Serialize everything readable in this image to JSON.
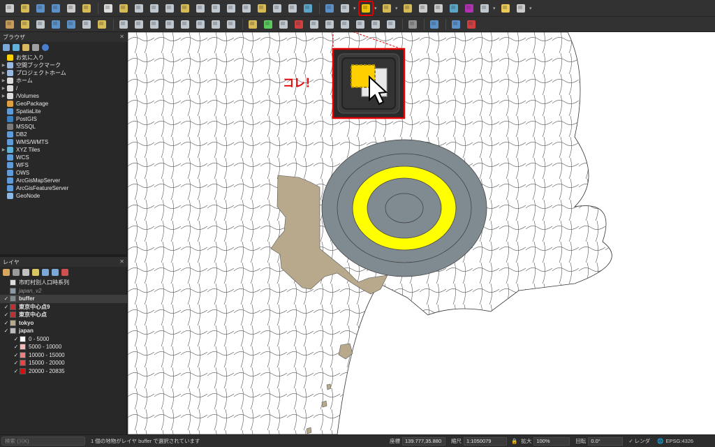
{
  "panels": {
    "browser": {
      "title": "ブラウザ",
      "items": [
        {
          "label": "お気に入り",
          "icon": "star-icon",
          "expand": false
        },
        {
          "label": "空間ブックマーク",
          "icon": "bookmark-icon",
          "expand": true
        },
        {
          "label": "プロジェクトホーム",
          "icon": "project-home-icon",
          "expand": true
        },
        {
          "label": "ホーム",
          "icon": "home-folder-icon",
          "expand": true
        },
        {
          "label": "/",
          "icon": "root-folder-icon",
          "expand": true
        },
        {
          "label": "/Volumes",
          "icon": "folder-icon",
          "expand": true
        },
        {
          "label": "GeoPackage",
          "icon": "geopackage-icon",
          "expand": false
        },
        {
          "label": "SpatiaLite",
          "icon": "spatialite-icon",
          "expand": false
        },
        {
          "label": "PostGIS",
          "icon": "postgis-icon",
          "expand": false
        },
        {
          "label": "MSSQL",
          "icon": "mssql-icon",
          "expand": false
        },
        {
          "label": "DB2",
          "icon": "db2-icon",
          "expand": false
        },
        {
          "label": "WMS/WMTS",
          "icon": "wms-icon",
          "expand": false
        },
        {
          "label": "XYZ Tiles",
          "icon": "xyz-tiles-icon",
          "expand": true
        },
        {
          "label": "WCS",
          "icon": "wcs-icon",
          "expand": false
        },
        {
          "label": "WFS",
          "icon": "wfs-icon",
          "expand": false
        },
        {
          "label": "OWS",
          "icon": "ows-icon",
          "expand": false
        },
        {
          "label": "ArcGisMapServer",
          "icon": "arcgis-map-icon",
          "expand": false
        },
        {
          "label": "ArcGisFeatureServer",
          "icon": "arcgis-feature-icon",
          "expand": false
        },
        {
          "label": "GeoNode",
          "icon": "geonode-icon",
          "expand": false
        }
      ]
    },
    "layers": {
      "title": "レイヤ",
      "items": [
        {
          "label": "市町村別人口時系列",
          "checked": false,
          "swatch": "#dddddd",
          "style": "normal",
          "indent": 0
        },
        {
          "label": "japan_v2",
          "checked": false,
          "swatch": "#8a9aa8",
          "style": "italic",
          "indent": 0
        },
        {
          "label": "buffer",
          "checked": true,
          "swatch": "#7f8a91",
          "style": "bold",
          "indent": 0
        },
        {
          "label": "東京中心点9",
          "checked": true,
          "swatch": "#c03030",
          "style": "bold",
          "indent": 0
        },
        {
          "label": "東京中心点",
          "checked": true,
          "swatch": "#c03030",
          "style": "bold",
          "indent": 0
        },
        {
          "label": "tokyo",
          "checked": true,
          "swatch": "#b9a98c",
          "style": "bold",
          "indent": 0
        },
        {
          "label": "japan",
          "checked": true,
          "swatch": "#bbbbbb",
          "style": "bold",
          "indent": 0
        },
        {
          "label": "0 - 5000",
          "checked": true,
          "swatch": "#ffffff",
          "style": "normal",
          "indent": 1
        },
        {
          "label": "5000 - 10000",
          "checked": true,
          "swatch": "#f5b9b9",
          "style": "normal",
          "indent": 1
        },
        {
          "label": "10000 - 15000",
          "checked": true,
          "swatch": "#ee7f7f",
          "style": "normal",
          "indent": 1
        },
        {
          "label": "15000 - 20000",
          "checked": true,
          "swatch": "#e84545",
          "style": "normal",
          "indent": 1
        },
        {
          "label": "20000 - 20835",
          "checked": true,
          "swatch": "#e00a0a",
          "style": "normal",
          "indent": 1
        }
      ]
    }
  },
  "annotation": {
    "text": "コレ！",
    "color": "#e60000"
  },
  "map": {
    "buffer_fill": "#7f8a91",
    "highlight_ring": "#ffff00",
    "tokyo_fill": "#b9a98c"
  },
  "status": {
    "search_placeholder": "検索 (⌘K)",
    "message": "1 個の地物がレイヤ buffer で選択されています",
    "coord_label": "座標",
    "coord_value": "139.777,35.880",
    "scale_label": "縮尺",
    "scale_value": "1:1050079",
    "magnify_label": "拡大",
    "magnify_value": "100%",
    "rotation_label": "回転",
    "rotation_value": "0.0°",
    "render_label": "レンダ",
    "crs_label": "EPSG:4326"
  }
}
